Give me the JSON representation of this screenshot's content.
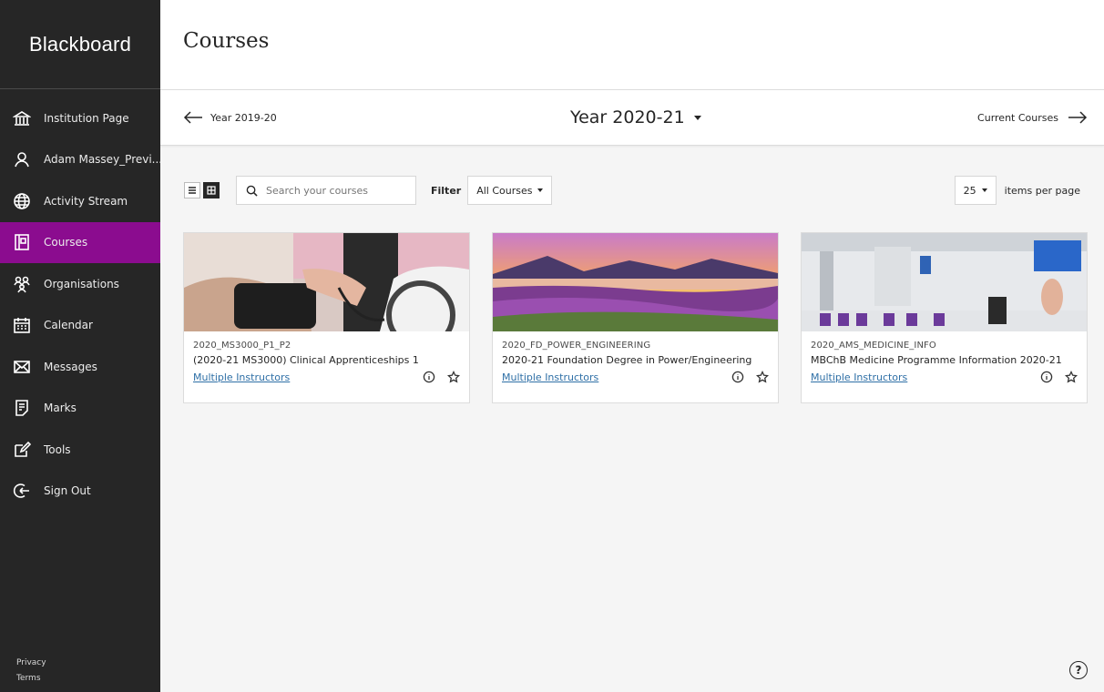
{
  "sidebar": {
    "logo": "Blackboard",
    "items": [
      {
        "label": "Institution Page",
        "icon": "institution-icon"
      },
      {
        "label": "Adam Massey_Previ...",
        "icon": "user-icon"
      },
      {
        "label": "Activity Stream",
        "icon": "globe-icon"
      },
      {
        "label": "Courses",
        "icon": "courses-icon",
        "active": true
      },
      {
        "label": "Organisations",
        "icon": "organisations-icon"
      },
      {
        "label": "Calendar",
        "icon": "calendar-icon"
      },
      {
        "label": "Messages",
        "icon": "envelope-icon"
      },
      {
        "label": "Marks",
        "icon": "marks-icon"
      },
      {
        "label": "Tools",
        "icon": "tools-icon"
      },
      {
        "label": "Sign Out",
        "icon": "sign-out-icon"
      }
    ],
    "footer": {
      "privacy": "Privacy",
      "terms": "Terms"
    }
  },
  "page": {
    "title": "Courses"
  },
  "year_nav": {
    "prev": "Year 2019-20",
    "current": "Year 2020-21",
    "next": "Current Courses"
  },
  "toolbar": {
    "search_placeholder": "Search your courses",
    "filter_label": "Filter",
    "filter_value": "All Courses",
    "per_page_value": "25",
    "per_page_label": "items per page"
  },
  "courses": [
    {
      "id": "2020_MS3000_P1_P2",
      "title": "(2020-21 MS3000) Clinical Apprenticeships 1",
      "instructors": "Multiple Instructors"
    },
    {
      "id": "2020_FD_POWER_ENGINEERING",
      "title": "2020-21 Foundation Degree in Power/Engineering",
      "instructors": "Multiple Instructors"
    },
    {
      "id": "2020_AMS_MEDICINE_INFO",
      "title": "MBChB Medicine Programme Information 2020-21",
      "instructors": "Multiple Instructors"
    }
  ],
  "help_label": "?",
  "colors": {
    "sidebar": "#262626",
    "active": "#8b0c8f",
    "link": "#2e6fa6"
  }
}
